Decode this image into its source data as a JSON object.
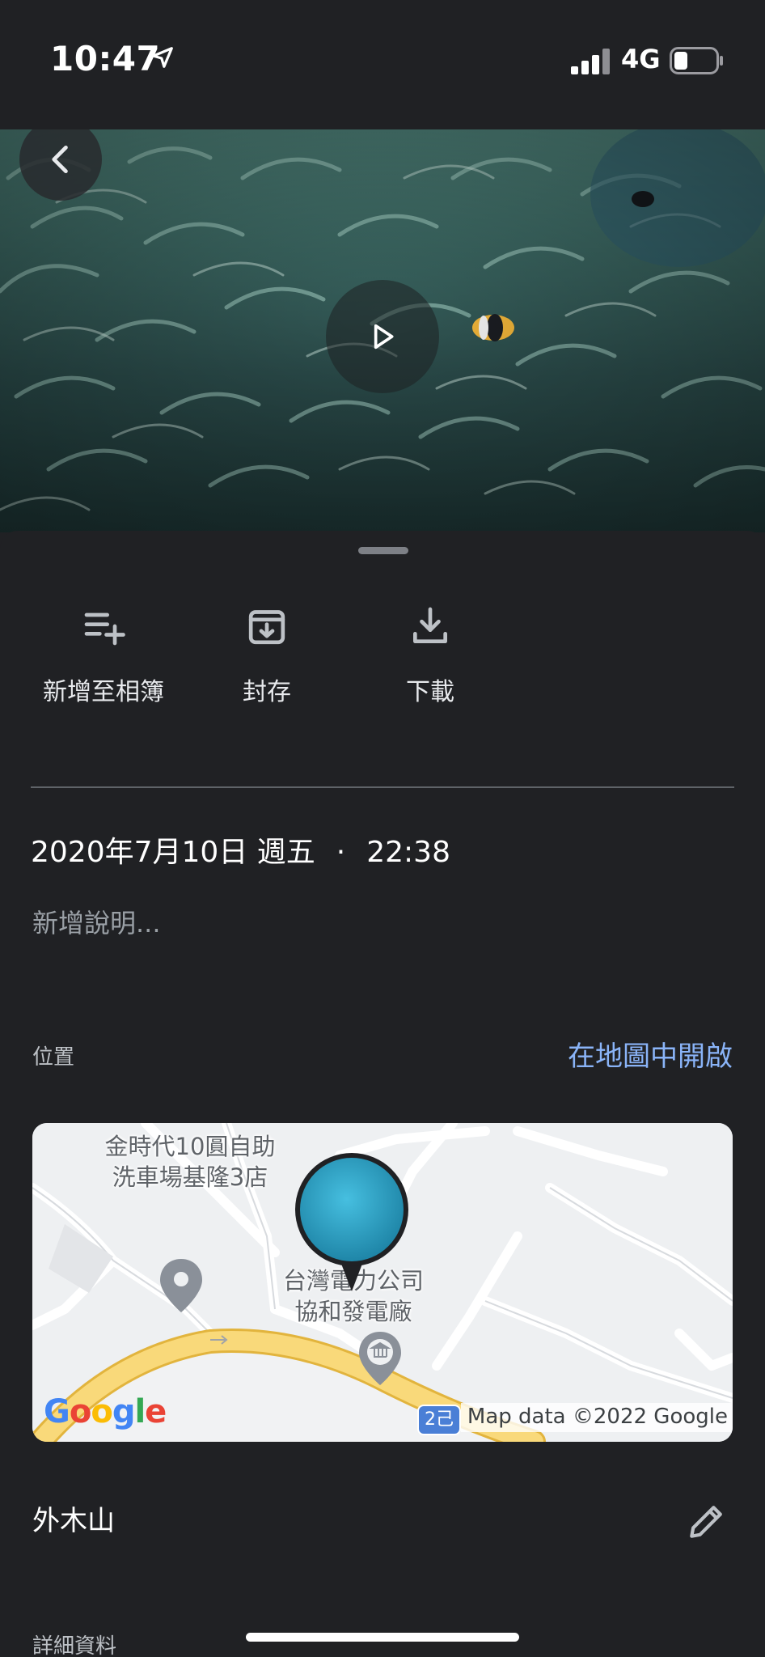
{
  "status_bar": {
    "time": "10:47",
    "network": "4G",
    "icons": [
      "location-arrow-icon",
      "signal-bars-icon",
      "battery-icon"
    ]
  },
  "video": {
    "back_icon": "chevron-left-icon",
    "play_icon": "play-icon"
  },
  "actions": [
    {
      "label": "新增至相簿",
      "icon": "playlist-add-icon"
    },
    {
      "label": "封存",
      "icon": "archive-icon"
    },
    {
      "label": "下載",
      "icon": "download-icon"
    }
  ],
  "info": {
    "date": "2020年7月10日 週五",
    "separator": "·",
    "time": "22:38",
    "description_placeholder": "新增說明..."
  },
  "location": {
    "label": "位置",
    "open_in_maps": "在地圖中開啟",
    "place_name": "外木山",
    "edit_icon": "pencil-icon"
  },
  "map": {
    "poi_1": "金時代10圓自助\n洗車場基隆3店",
    "poi_2": "台灣電力公司\n協和發電廠",
    "road_badge": "2己",
    "logo": "Google",
    "credit": "Map data ©2022 Google"
  },
  "details": {
    "label": "詳細資料"
  },
  "colors": {
    "background": "#202124",
    "accent_link": "#8ab4f8",
    "divider": "#5f6368",
    "secondary_text": "#9aa0a6",
    "map_road": "#f7cf5c"
  }
}
